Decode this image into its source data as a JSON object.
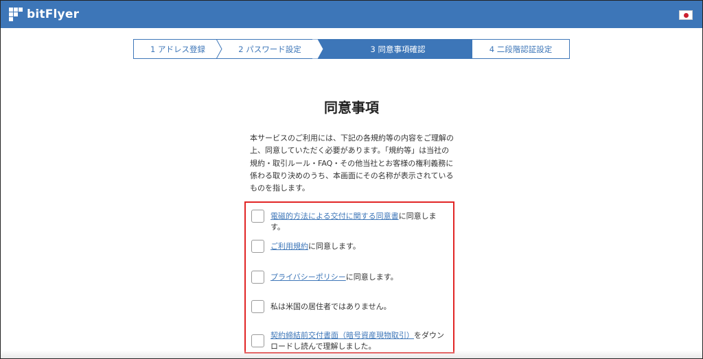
{
  "brand": {
    "name": "bitFlyer"
  },
  "locale": {
    "flag": "japan-flag-icon"
  },
  "steps": [
    {
      "label": "1 アドレス登録",
      "state": "done"
    },
    {
      "label": "2 パスワード設定",
      "state": "done"
    },
    {
      "label": "3 同意事項確認",
      "state": "current"
    },
    {
      "label": "4 二段階認証設定",
      "state": "todo"
    }
  ],
  "page": {
    "title": "同意事項",
    "intro": "本サービスのご利用には、下記の各規約等の内容をご理解の上、同意していただく必要があります。「規約等」は当社の規約・取引ルール・FAQ・その他当社とお客様の権利義務に係わる取り決めのうち、本画面にその名称が表示されているものを指します。"
  },
  "consents": [
    {
      "link": "電磁的方法による交付に関する同意書",
      "suffix": "に同意します。",
      "checked": false
    },
    {
      "link": "ご利用規約",
      "suffix": "に同意します。",
      "checked": false
    },
    {
      "link": "プライバシーポリシー",
      "suffix": "に同意します。",
      "checked": false
    },
    {
      "link": "",
      "suffix": "私は米国の居住者ではありません。",
      "checked": false
    },
    {
      "link": "契約締結前交付書面（暗号資産現物取引）",
      "suffix": "をダウンロードし読んで理解しました。",
      "checked": false
    }
  ],
  "colors": {
    "brand_blue": "#3d76b8",
    "highlight_red": "#e12424"
  }
}
